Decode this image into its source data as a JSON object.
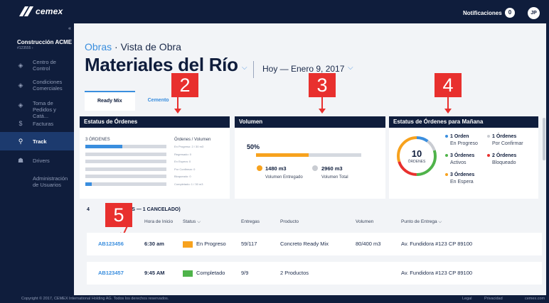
{
  "topbar": {
    "logo_text": "cemex",
    "notifications_label": "Notificaciones",
    "notifications_count": "0",
    "avatar_initials": "JP"
  },
  "sidebar": {
    "collapse": "«",
    "company": "Construcción ACME",
    "company_id": "#123555 ›",
    "items": [
      {
        "icon": "home-icon",
        "glyph": "◈",
        "label": "Centro de Control"
      },
      {
        "icon": "commercial-icon",
        "glyph": "◈",
        "label": "Condiciones Comerciales"
      },
      {
        "icon": "order-icon",
        "glyph": "◈",
        "label": "Toma de Pedidos y Catá..."
      },
      {
        "icon": "invoice-icon",
        "glyph": "$",
        "label": "Facturas"
      },
      {
        "icon": "track-pin-icon",
        "glyph": "⚲",
        "label": "Track"
      },
      {
        "icon": "drivers-icon",
        "glyph": "☗",
        "label": "Drivers"
      },
      {
        "icon": "",
        "glyph": "",
        "label": "Administración de Usuarios"
      }
    ]
  },
  "header": {
    "breadcrumb_link": "Obras",
    "breadcrumb_sep": " · ",
    "breadcrumb_current": "Vista de Obra",
    "title": "Materiales del Río",
    "title_chevron": "⌵",
    "date_filter": "Hoy — Enero 9, 2017",
    "date_chevron": "⌵"
  },
  "tabs": [
    {
      "label": "Ready Mix"
    },
    {
      "label": "Cemento"
    }
  ],
  "markers": [
    "2",
    "3",
    "4",
    "5"
  ],
  "orders_status": {
    "title": "Estatus de Órdenes",
    "count_label": "3 ÓRDENES",
    "column_label": "Órdenes / Volumen",
    "rows": [
      {
        "label": "En Progreso: 2 / 30 m3",
        "fill": 0.46
      },
      {
        "label": "Regresado: 0",
        "fill": 0
      },
      {
        "label": "En Espera: 0",
        "fill": 0
      },
      {
        "label": "Por Confirmar: 0",
        "fill": 0
      },
      {
        "label": "Bloqueado: 0",
        "fill": 0
      },
      {
        "label": "Completado: 1 / 30 m3",
        "fill": 0.08
      }
    ]
  },
  "volume": {
    "title": "Volumen",
    "percent": "50%",
    "fill": 0.5,
    "delivered_value": "1480 m3",
    "delivered_label": "Volumen Entregado",
    "total_value": "2960 m3",
    "total_label": "Volumen Total",
    "delivered_color": "#f7a21e",
    "total_color": "#c9ccd2"
  },
  "tomorrow": {
    "title": "Estatus de Órdenes para Mañana",
    "total": "10",
    "total_label": "ÓRDENES",
    "items": [
      {
        "count": "1 Orden",
        "status": "En Progreso",
        "color": "#3a8ede"
      },
      {
        "count": "1 Órdenes",
        "status": "Por Confirmar",
        "color": "#c9ccd2"
      },
      {
        "count": "3 Órdenes",
        "status": "Activos",
        "color": "#4fb34a"
      },
      {
        "count": "2 Órdenes",
        "status": "Bloqueado",
        "color": "#e8302e"
      },
      {
        "count": "3 Órdenes",
        "status": "En Espera",
        "color": "#f7a21e"
      }
    ]
  },
  "orders_table": {
    "summary_prefix": "4",
    "summary_suffix": "ERTOS — 1 CANCELADO)",
    "headers": {
      "time": "Hora de Inicio",
      "status": "Status",
      "status_chevron": "⌵",
      "deliveries": "Entregas",
      "product": "Producto",
      "volume": "Volumen",
      "point": "Punto de Entrega",
      "point_chevron": "⌵"
    },
    "rows": [
      {
        "id": "AB123456",
        "time": "6:30 am",
        "status": "En Progreso",
        "status_color": "#f7a21e",
        "deliveries": "59/117",
        "product": "Concreto Ready Mix",
        "volume": "80/400 m3",
        "point": "Av. Fundidora #123 CP 89100"
      },
      {
        "id": "AB123457",
        "time": "9:45 AM",
        "status": "Completado",
        "status_color": "#4fb34a",
        "deliveries": "9/9",
        "product": "2 Productos",
        "volume": "",
        "point": "Av. Fundidora #123 CP 89100"
      }
    ]
  },
  "footer": {
    "copyright": "Copyright © 2017, CEMEX International Holding AG. Todos los derechos reservados.",
    "links": [
      "Legal",
      "Privacidad",
      "cemex.com"
    ]
  }
}
